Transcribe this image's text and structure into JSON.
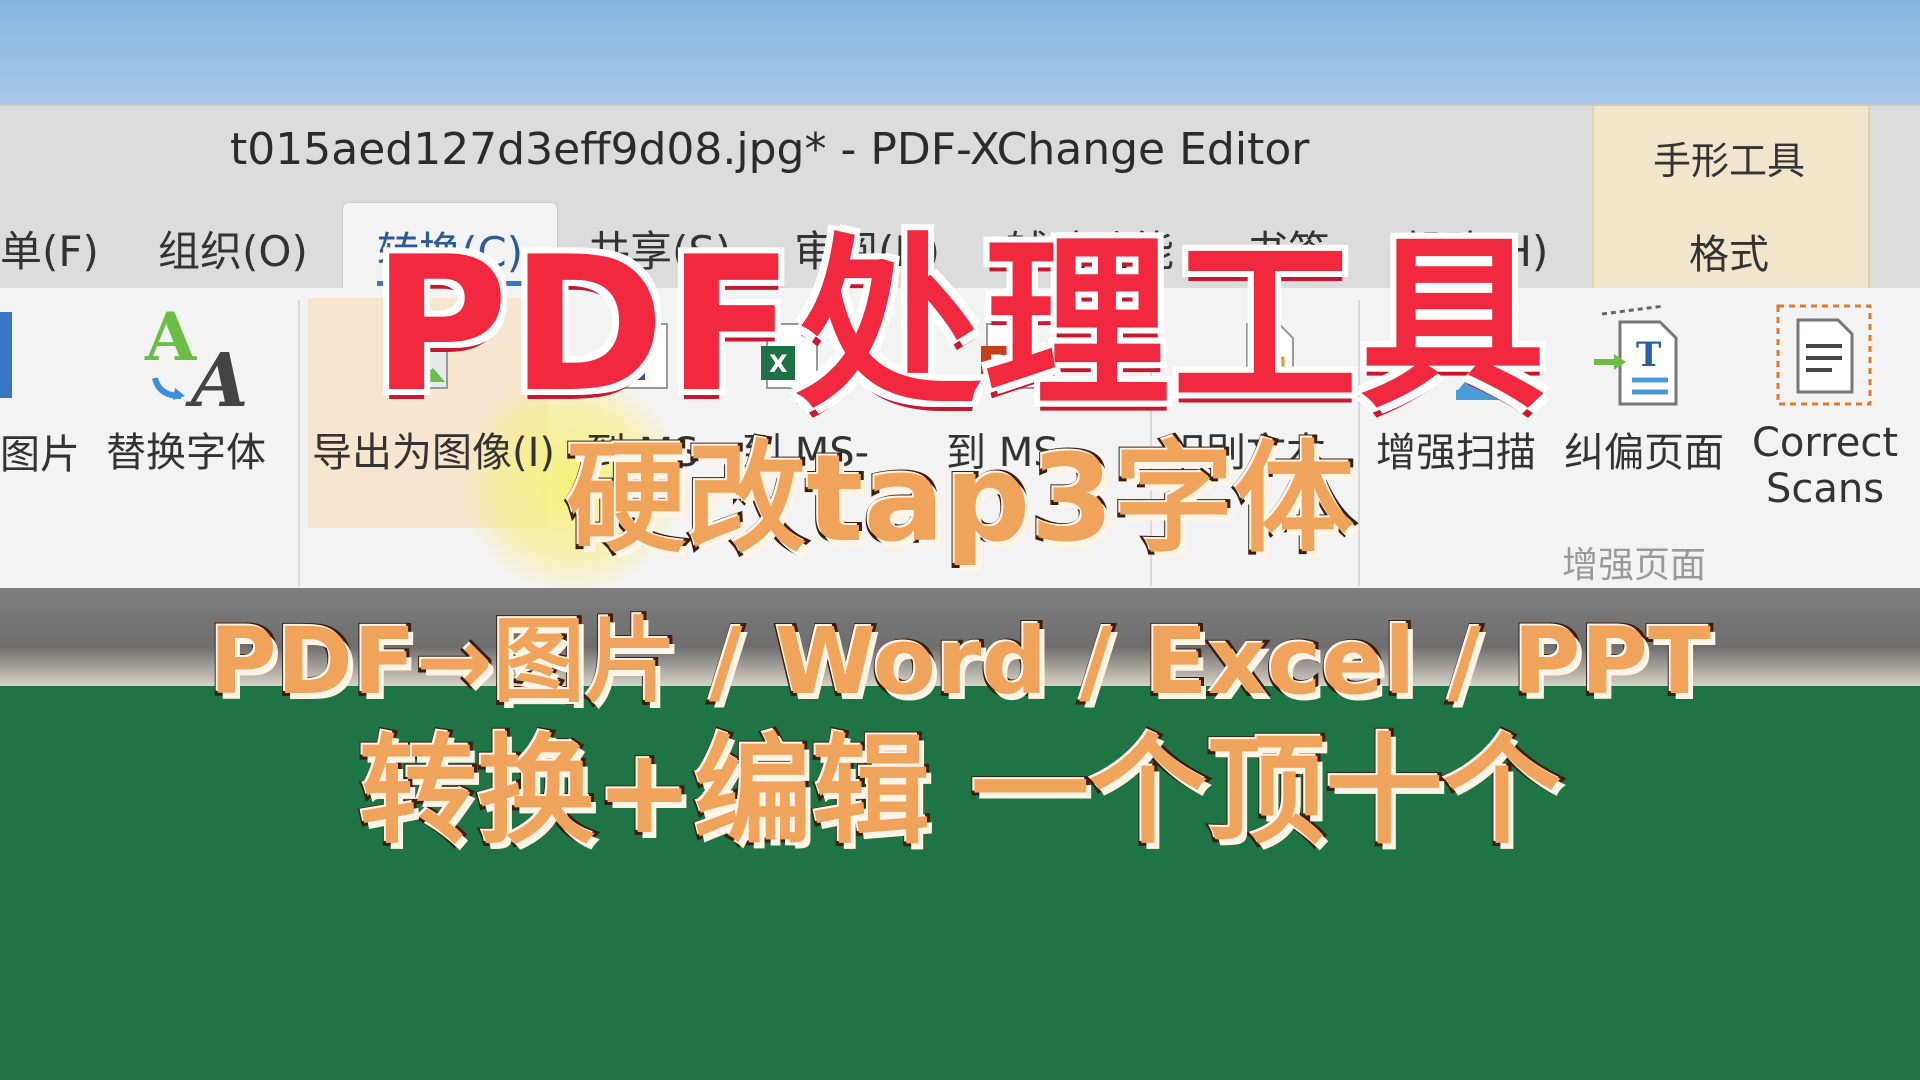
{
  "window": {
    "title": "t015aed127d3eff9d08.jpg* - PDF-XChange Editor"
  },
  "contextual": {
    "group": "手形工具",
    "tab": "格式"
  },
  "tabs": [
    {
      "label": "单(F)"
    },
    {
      "label": "组织(O)"
    },
    {
      "label": "转换(C)"
    },
    {
      "label": "共享(S)"
    },
    {
      "label": "审阅(R)"
    },
    {
      "label": "辅助功能"
    },
    {
      "label": "书签"
    },
    {
      "label": "帮助(H)"
    }
  ],
  "ribbon": {
    "buttons": [
      {
        "label": "图片",
        "icon": "image-icon"
      },
      {
        "label": "替换字体",
        "icon": "replace-font-icon"
      },
      {
        "label": "导出为图像(I)",
        "icon": "export-image-icon"
      },
      {
        "label": "到 MS-",
        "icon": "word-icon"
      },
      {
        "label": "到 MS-",
        "icon": "excel-icon"
      },
      {
        "label": "到 MS-",
        "icon": "powerpoint-icon"
      },
      {
        "label": "识别文本",
        "icon": "ocr-icon"
      },
      {
        "label": "增强扫描",
        "icon": "enhance-scan-icon"
      },
      {
        "label": "纠偏页面",
        "icon": "deskew-icon"
      },
      {
        "label_line1": "Correct",
        "label_line2": "Scans",
        "icon": "correct-scans-icon"
      }
    ],
    "group_label": "增强页面"
  },
  "overlay": {
    "headline": "PDF处理工具",
    "sub": "硬改tap3字体",
    "line3": "PDF→图片 / Word / Excel / PPT",
    "line4": "转换+编辑 一个顶十个"
  },
  "colors": {
    "headline_red": "#f2283f",
    "subtitle_orange": "#f0a45b",
    "tab_accent": "#3a76c4",
    "background_green": "#1f7445"
  }
}
